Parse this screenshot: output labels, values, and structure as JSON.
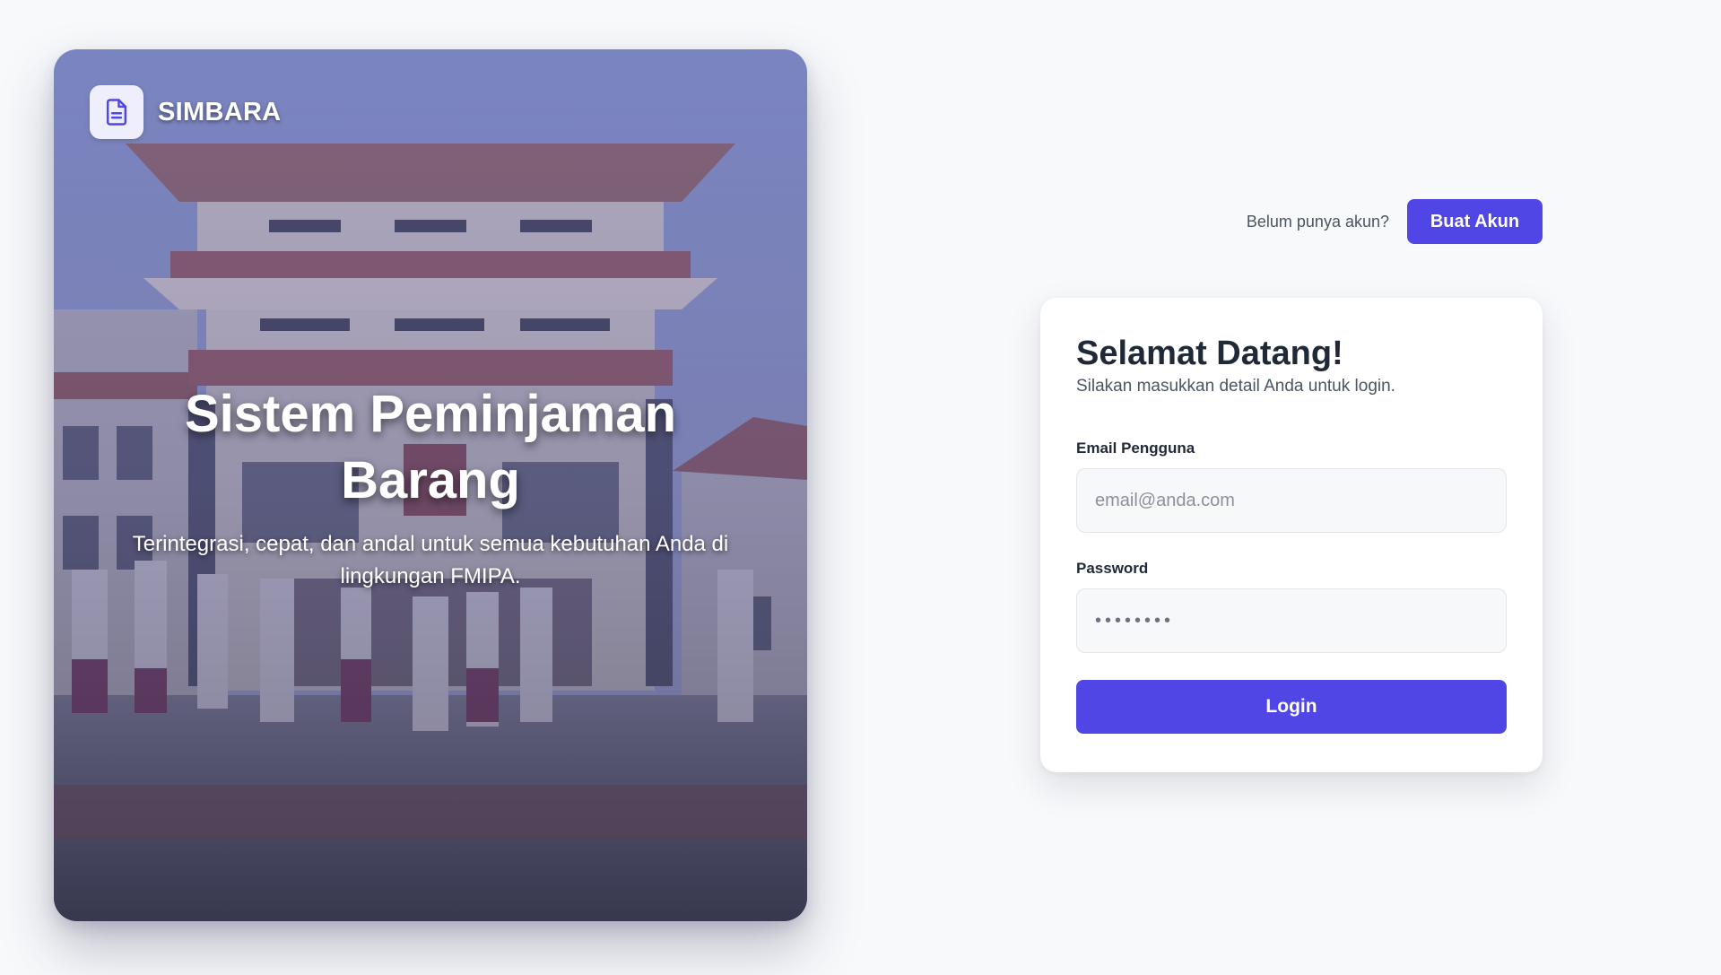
{
  "brand": {
    "name": "SIMBARA",
    "icon": "document-icon"
  },
  "hero": {
    "title": "Sistem Peminjaman Barang",
    "subtitle": "Terintegrasi, cepat, dan andal untuk semua kebutuhan Anda di lingkungan FMIPA."
  },
  "signup": {
    "prompt": "Belum punya akun?",
    "button_label": "Buat Akun"
  },
  "login_card": {
    "title": "Selamat Datang!",
    "subtitle": "Silakan masukkan detail Anda untuk login.",
    "email": {
      "label": "Email Pengguna",
      "placeholder": "email@anda.com",
      "value": ""
    },
    "password": {
      "label": "Password",
      "value": "••••••••"
    },
    "submit_label": "Login"
  },
  "colors": {
    "accent": "#4f46e5",
    "page_background": "#f8f9fb",
    "card_background": "#ffffff",
    "heading_text": "#1f2937",
    "muted_text": "#4b5563"
  }
}
